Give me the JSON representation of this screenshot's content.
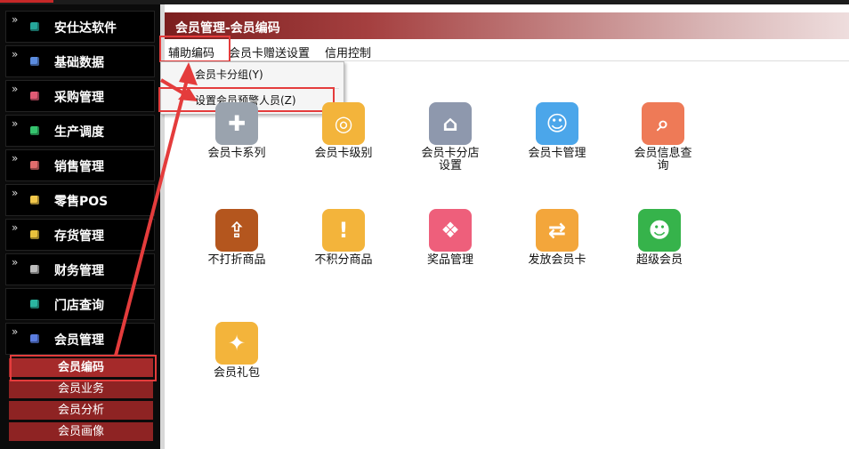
{
  "sidebar": {
    "items": [
      {
        "label": "安仕达软件",
        "color": "#26a69a"
      },
      {
        "label": "基础数据",
        "color": "#5c8de0"
      },
      {
        "label": "采购管理",
        "color": "#e25b74"
      },
      {
        "label": "生产调度",
        "color": "#35c46e"
      },
      {
        "label": "销售管理",
        "color": "#e06d6d"
      },
      {
        "label": "零售POS",
        "color": "#f2c84b"
      },
      {
        "label": "存货管理",
        "color": "#e9c23d"
      },
      {
        "label": "财务管理",
        "color": "#bdbdbd"
      },
      {
        "label": "门店查询",
        "color": "#2bb5a0"
      },
      {
        "label": "会员管理",
        "color": "#5b7de0"
      }
    ],
    "sub_items": [
      "会员编码",
      "会员业务",
      "会员分析",
      "会员画像"
    ]
  },
  "header": {
    "title": "会员管理-会员编码"
  },
  "menu": {
    "items": [
      "辅助编码",
      "会员卡赠送设置",
      "信用控制"
    ]
  },
  "dropdown": {
    "items": [
      "会员卡分组(Y)",
      "设置会员预警人员(Z)"
    ]
  },
  "tiles": [
    {
      "label": "会员卡系列",
      "icon": "grid-icon",
      "color": "#9aa3ae",
      "glyph": "✚"
    },
    {
      "label": "会员卡级别",
      "icon": "coins-icon",
      "color": "#f3b43b",
      "glyph": "◎"
    },
    {
      "label": "会员卡分店设置",
      "icon": "home-icon",
      "color": "#8e98ad",
      "glyph": "⌂"
    },
    {
      "label": "会员卡管理",
      "icon": "user-card-icon",
      "color": "#4ba6ea",
      "glyph": "☺"
    },
    {
      "label": "会员信息查询",
      "icon": "document-search-icon",
      "color": "#ee7a57",
      "glyph": "⌕"
    },
    {
      "label": "不打折商品",
      "icon": "upload-box-icon",
      "color": "#b4561e",
      "glyph": "⇪"
    },
    {
      "label": "不积分商品",
      "icon": "exclamation-icon",
      "color": "#f3b43b",
      "glyph": "!"
    },
    {
      "label": "奖品管理",
      "icon": "gift-icon",
      "color": "#ee5f7b",
      "glyph": "❖"
    },
    {
      "label": "发放会员卡",
      "icon": "transfer-icon",
      "color": "#f3a63b",
      "glyph": "⇄"
    },
    {
      "label": "超级会员",
      "icon": "super-user-icon",
      "color": "#36b34b",
      "glyph": "☻"
    },
    {
      "label": "会员礼包",
      "icon": "puzzle-icon",
      "color": "#f3b43b",
      "glyph": "✦"
    }
  ]
}
